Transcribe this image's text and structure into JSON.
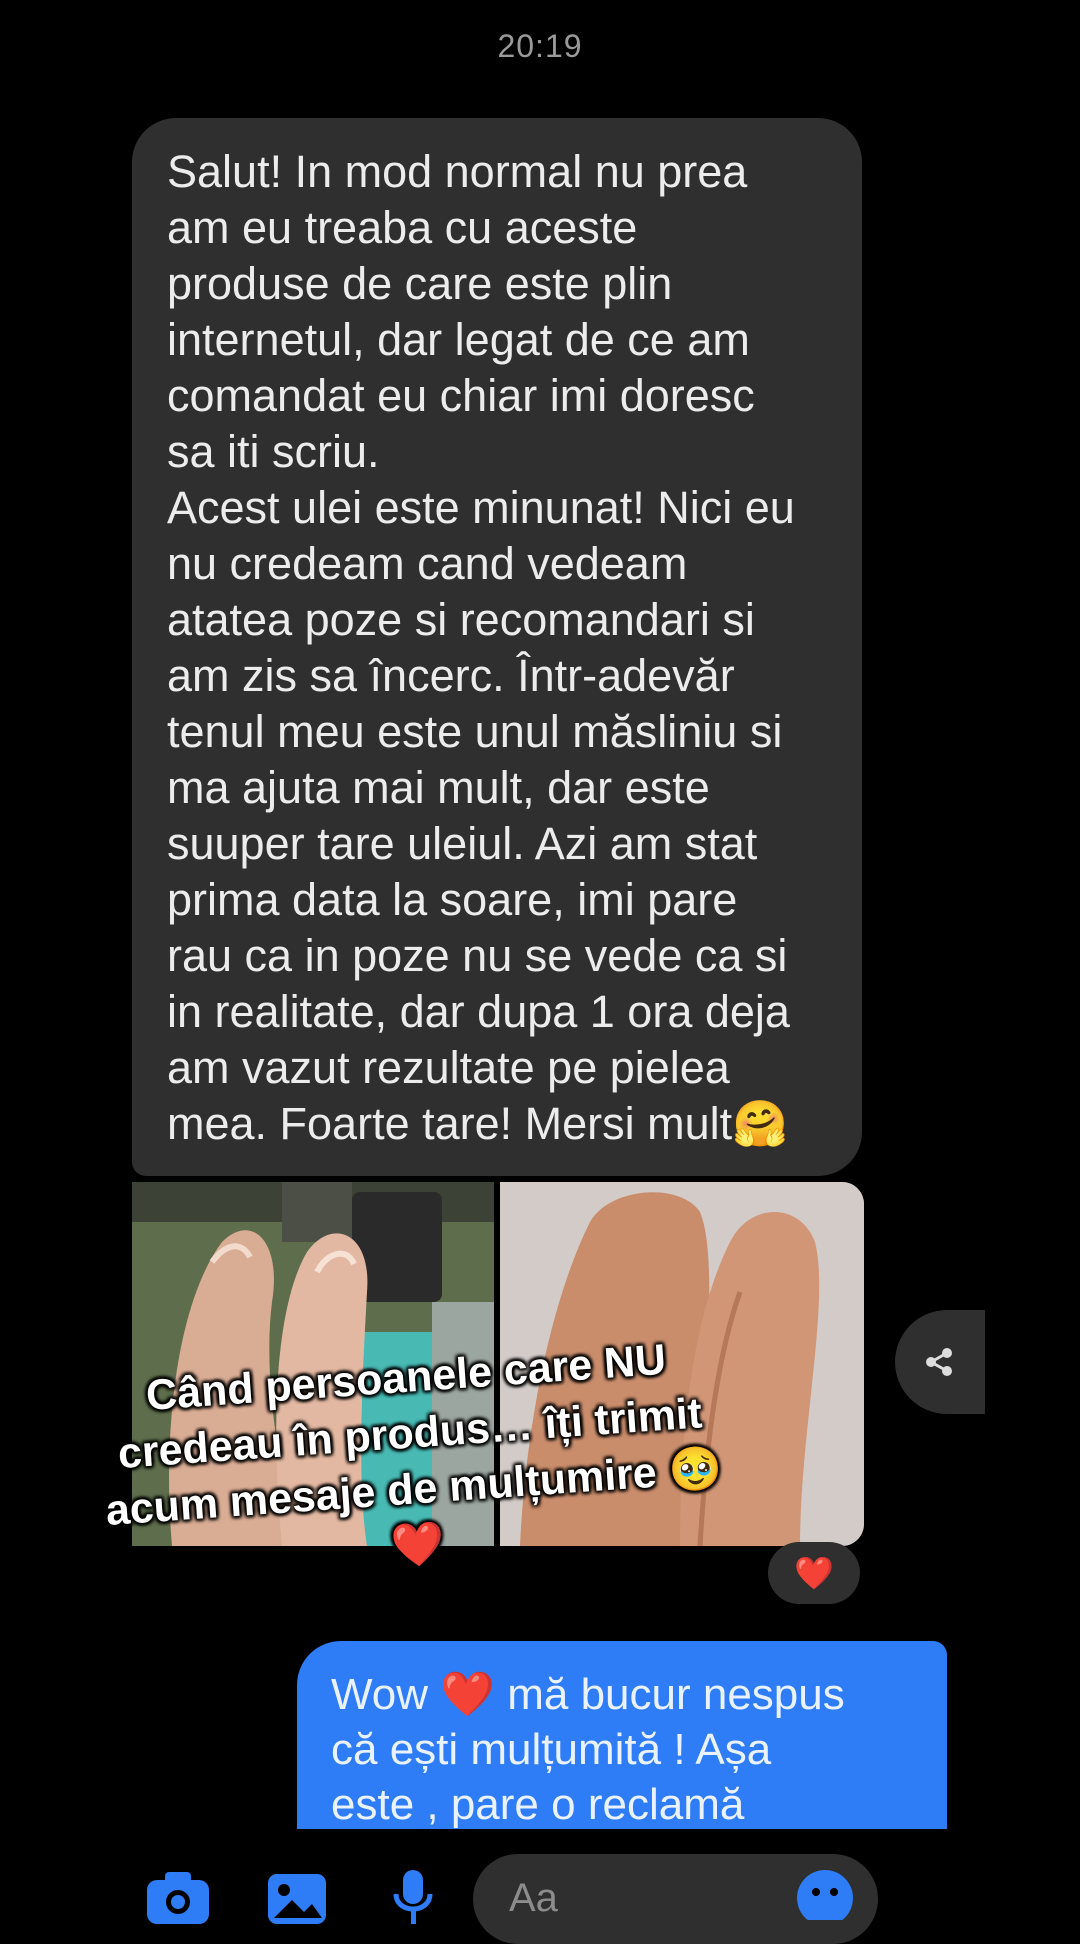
{
  "timestamp": "20:19",
  "incoming_message": {
    "lines": [
      "Salut! In mod normal nu prea",
      "am eu treaba cu aceste",
      "produse de care este plin",
      "internetul, dar legat de ce am",
      "comandat eu chiar imi doresc",
      "sa iti scriu.",
      "Acest ulei este minunat! Nici eu",
      "nu credeam cand vedeam",
      "atatea poze si recomandari si",
      "am zis sa încerc. Într-adevăr",
      "tenul meu este unul măsliniu si",
      "ma ajuta mai mult, dar este",
      "suuper tare uleiul. Azi am stat",
      "prima data la soare, imi pare",
      "rau ca in poze nu se vede ca si",
      "in realitate, dar dupa 1 ora deja",
      "am vazut rezultate pe pielea",
      "mea. Foarte tare! Mersi mult🤗"
    ]
  },
  "reaction": {
    "emoji": "❤️"
  },
  "caption": {
    "lines": [
      "Când persoanele care NU",
      "credeau în produs… îți trimit",
      "acum mesaje de mulțumire 🥹",
      "❤️"
    ]
  },
  "outgoing_message": {
    "lines": [
      "Wow ❤️ mă bucur nespus",
      "că ești mulțumită ! Așa",
      "este , pare o reclamă"
    ]
  },
  "composer": {
    "placeholder": "Aa"
  },
  "icons": {
    "camera": "camera-icon",
    "gallery": "gallery-icon",
    "mic": "microphone-icon",
    "emoji": "emoji-icon",
    "share": "share-icon"
  },
  "colors": {
    "incoming_bubble": "#2f2f2f",
    "outgoing_bubble": "#2e7cf6",
    "accent_icon": "#2e7cf6"
  }
}
